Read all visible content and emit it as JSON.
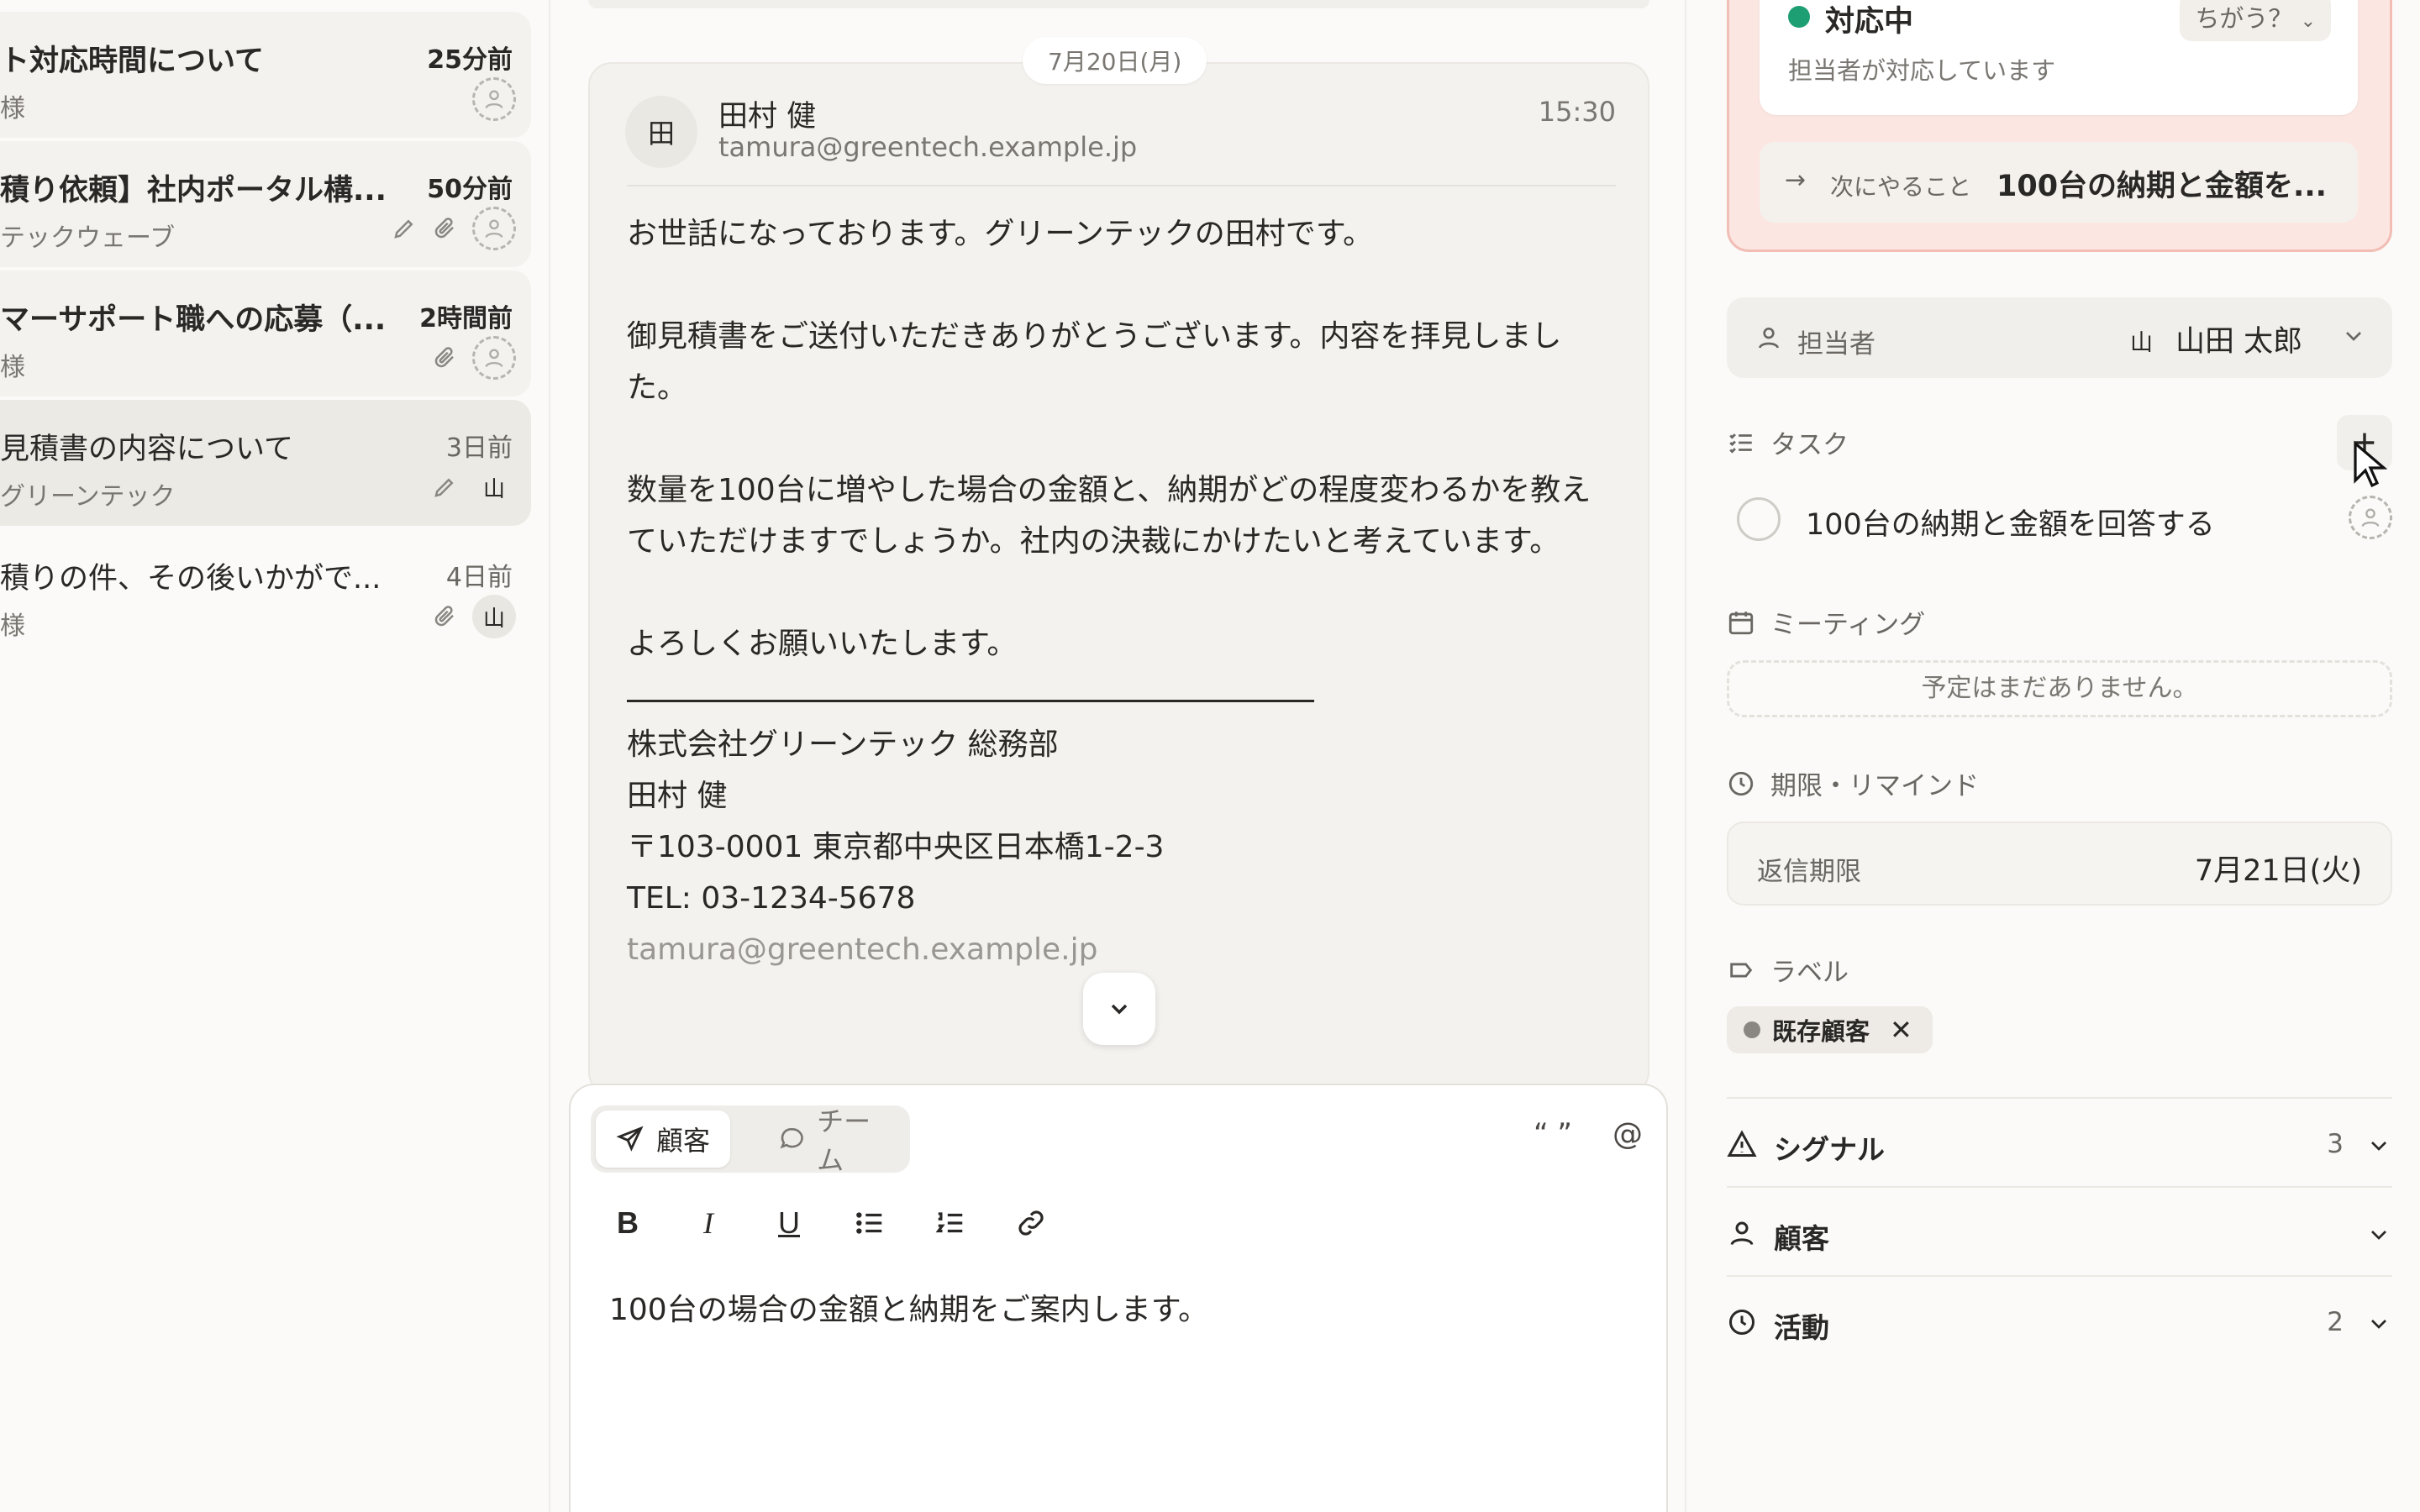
{
  "conversations": [
    {
      "subject": "ト対応時間について",
      "time": "25分前",
      "from": "様",
      "unread": true
    },
    {
      "subject": "積り依頼】社内ポータル構...",
      "time": "50分前",
      "from": "テックウェーブ",
      "unread": true
    },
    {
      "subject": "マーサポート職への応募（...",
      "time": "2時間前",
      "from": "様",
      "unread": true
    },
    {
      "subject": "見積書の内容について",
      "time": "3日前",
      "from": "グリーンテック",
      "avatar": "山",
      "active": true
    },
    {
      "subject": "積りの件、その後いかがで...",
      "time": "4日前",
      "from": "様",
      "avatar": "山"
    }
  ],
  "message": {
    "date": "7月20日(月)",
    "avatar": "田",
    "sender_name": "田村 健",
    "sender_email": "tamura@greentech.example.jp",
    "time": "15:30",
    "paragraphs": [
      "お世話になっております。グリーンテックの田村です。",
      "御見積書をご送付いただきありがとうございます。内容を拝見しました。",
      "数量を100台に増やした場合の金額と、納期がどの程度変わるかを教えていただけますでしょうか。社内の決裁にかけたいと考えています。",
      "よろしくお願いいたします。"
    ],
    "signature": [
      "株式会社グリーンテック 総務部",
      "田村 健",
      "〒103-0001 東京都中央区日本橋1-2-3",
      "TEL: 03-1234-5678",
      "tamura@greentech.example.jp"
    ]
  },
  "composer": {
    "tab_customer": "顧客",
    "tab_team": "チーム",
    "quote_glyph": "“ ”",
    "mention_glyph": "@",
    "draft_text": "100台の場合の金額と納期をご案内します。"
  },
  "sidebar": {
    "status_title": "対応中",
    "status_sub": "担当者が対応しています",
    "status_change": "ちがう？",
    "next_label": "次にやること",
    "next_value": "100台の納期と金額を...",
    "assignee_label": "担当者",
    "assignee_initial": "山",
    "assignee_name": "山田 太郎",
    "tasks_label": "タスク",
    "task_text": "100台の納期と金額を回答する",
    "meetings_label": "ミーティング",
    "meetings_empty": "予定はまだありません。",
    "deadline_label": "期限・リマインド",
    "reply_due_label": "返信期限",
    "reply_due_value": "7月21日(火)",
    "labels_label": "ラベル",
    "label_tag": "既存顧客",
    "signals_label": "シグナル",
    "signals_count": "3",
    "customer_label": "顧客",
    "activity_label": "活動",
    "activity_count": "2"
  },
  "colors": {
    "status_green": "#1e9e73",
    "status_bg": "#fbe6e2",
    "status_border": "#f1bdb4"
  }
}
